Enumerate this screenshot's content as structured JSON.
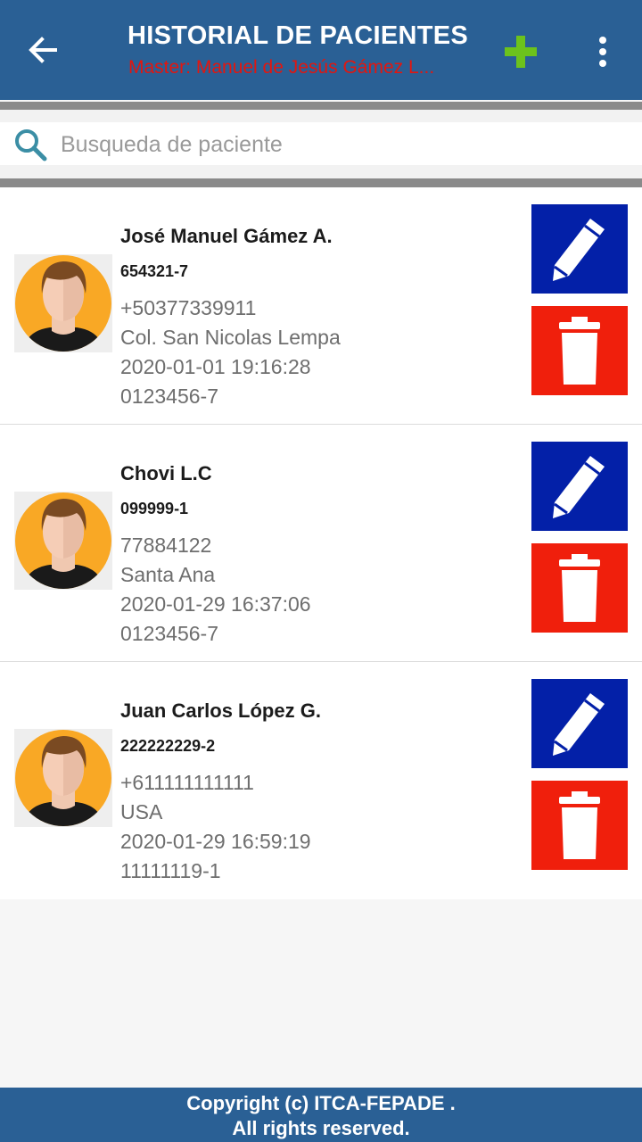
{
  "appbar": {
    "title": "HISTORIAL DE PACIENTES",
    "subtitle": "Master: Manuel de Jesús Gámez L...",
    "back_icon": "arrow-left-icon",
    "add_icon": "plus-icon",
    "more_icon": "more-vert-icon",
    "colors": {
      "bar": "#2a6095",
      "subtitle": "#e3160f",
      "add": "#6cc21c"
    }
  },
  "search": {
    "placeholder": "Busqueda de paciente",
    "value": "",
    "icon": "search-icon"
  },
  "patients": [
    {
      "name": "José Manuel Gámez A.",
      "code": "654321-7",
      "phone": "+50377339911",
      "address": "Col. San Nicolas Lempa",
      "datetime": "2020-01-01 19:16:28",
      "dui": "0123456-7"
    },
    {
      "name": "Chovi L.C",
      "code": "099999-1",
      "phone": "77884122",
      "address": "Santa Ana",
      "datetime": "2020-01-29 16:37:06",
      "dui": "0123456-7"
    },
    {
      "name": "Juan Carlos López G.",
      "code": "222222229-2",
      "phone": "+611111111111",
      "address": "USA",
      "datetime": "2020-01-29 16:59:19",
      "dui": "11111119-1"
    }
  ],
  "actions": {
    "edit_icon": "pencil-icon",
    "delete_icon": "trash-icon",
    "edit_color": "#0320a8",
    "delete_color": "#f01f0c"
  },
  "footer": {
    "line1": "Copyright (c) ITCA-FEPADE .",
    "line2": "All rights reserved."
  }
}
